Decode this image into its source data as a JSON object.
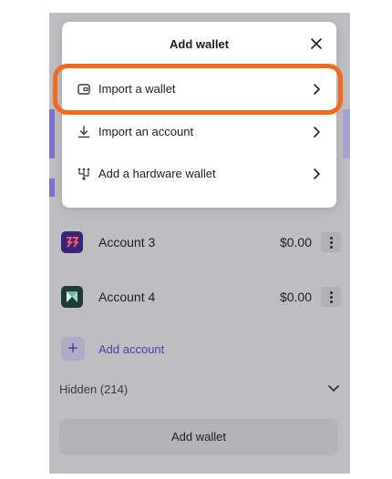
{
  "modal": {
    "title": "Add wallet",
    "options": [
      {
        "label": "Import a wallet",
        "icon": "wallet-icon"
      },
      {
        "label": "Import an account",
        "icon": "download-icon"
      },
      {
        "label": "Add a hardware wallet",
        "icon": "hardware-icon"
      }
    ]
  },
  "accounts": [
    {
      "name": "Account 3",
      "balance": "$0.00",
      "avatar_color": "#3a2478",
      "avatar_accent": "#e85a6a"
    },
    {
      "name": "Account 4",
      "balance": "$0.00",
      "avatar_color": "#1f3a38",
      "avatar_accent": "#e8e8e8"
    }
  ],
  "add_account_label": "Add account",
  "hidden_label": "Hidden (214)",
  "add_wallet_button": "Add wallet",
  "colors": {
    "highlight": "#f26a1b",
    "accent": "#4a43a8"
  }
}
